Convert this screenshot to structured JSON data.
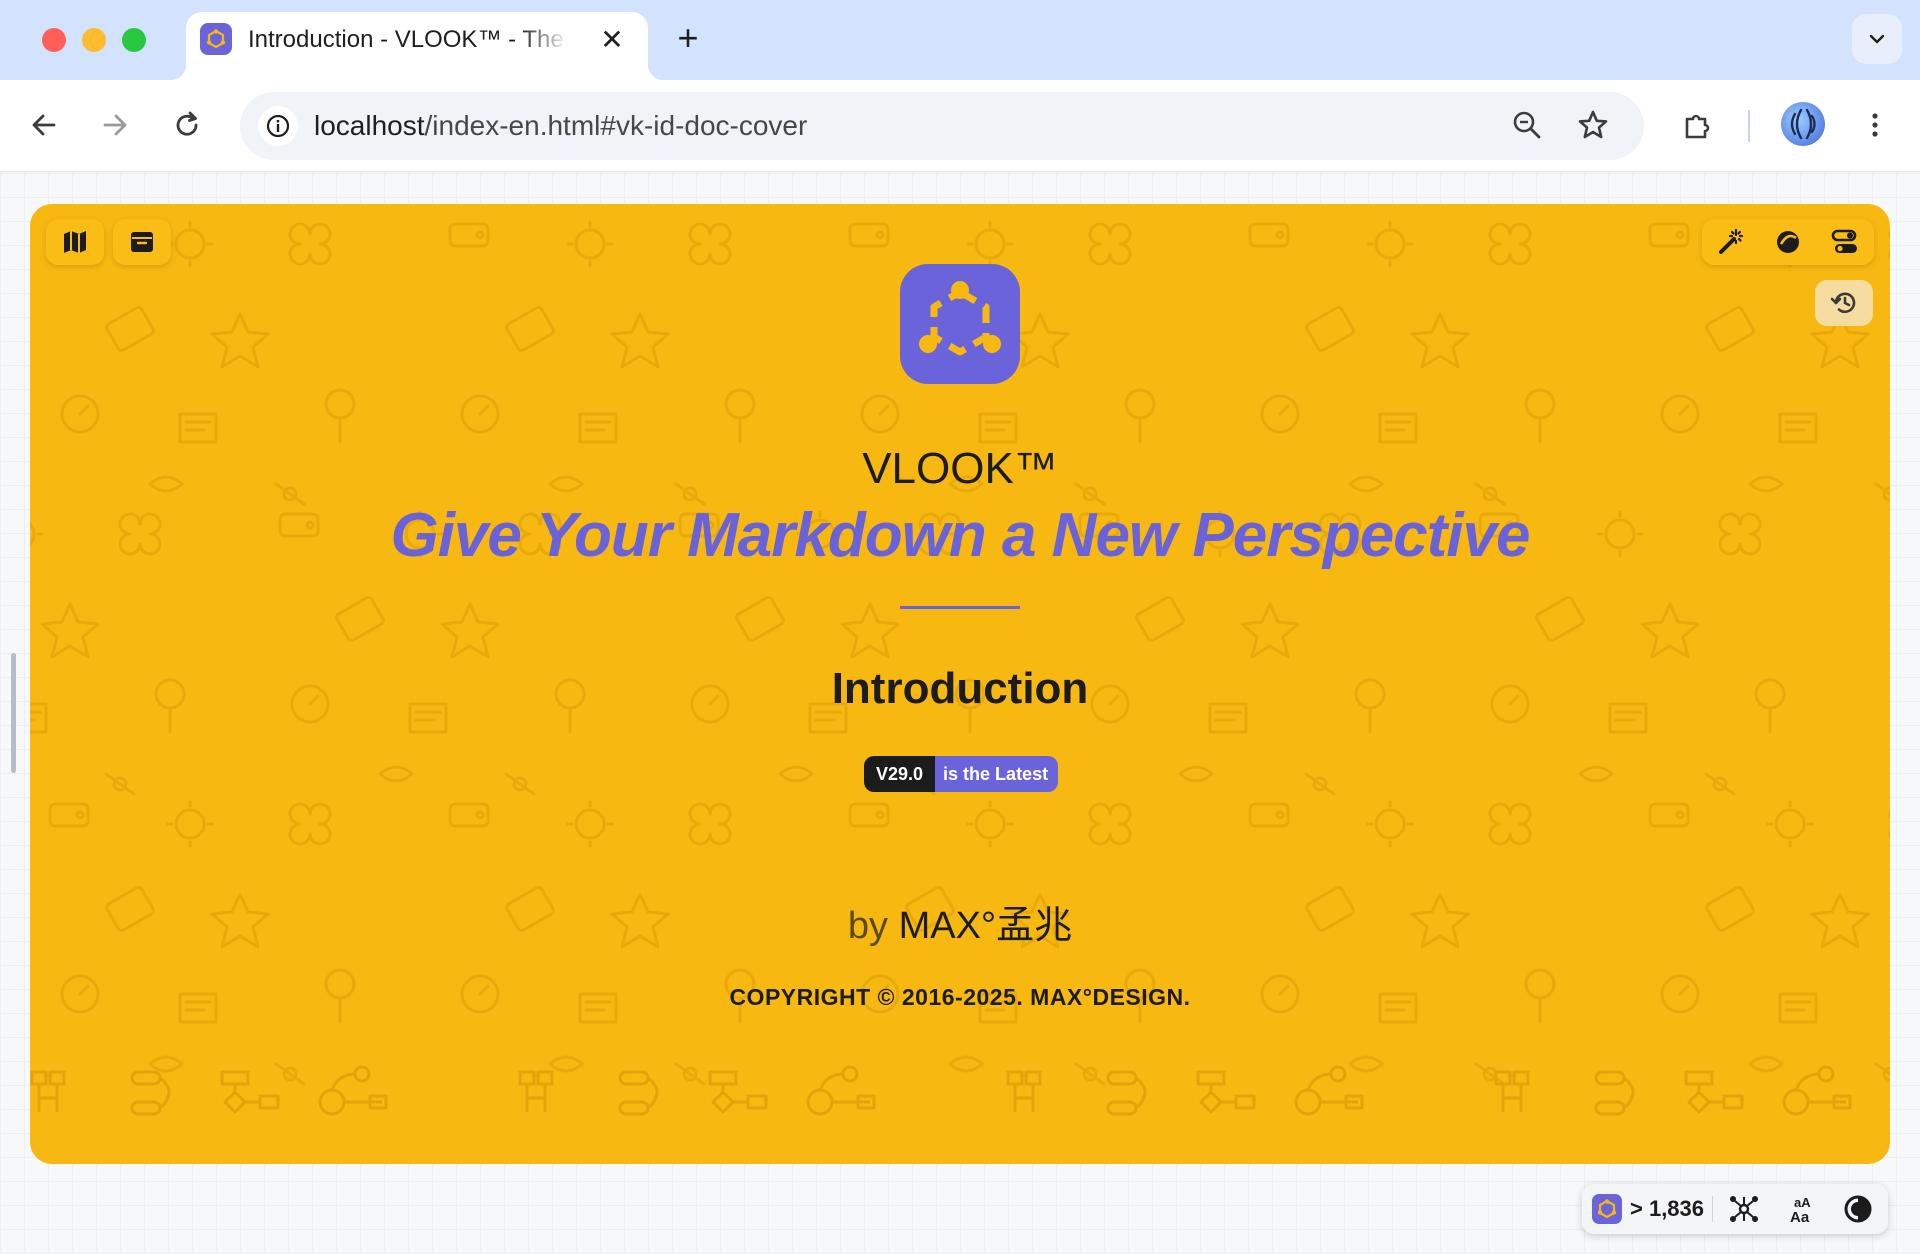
{
  "browser": {
    "tab": {
      "title": "Introduction - VLOOK™ - The Elegant & Practical THEME for Markdown"
    },
    "address_bar": {
      "host": "localhost",
      "path": "/index-en.html#vk-id-doc-cover"
    }
  },
  "cover": {
    "brand": "VLOOK™",
    "tagline": "Give Your Markdown a New Perspective",
    "doc_title": "Introduction",
    "badge": {
      "version": "V29.0",
      "message": "is the Latest"
    },
    "author": {
      "prefix": "by",
      "name": "MAX°孟兆"
    },
    "copyright": "COPYRIGHT © 2016-2025. MAX°DESIGN.",
    "colors": {
      "background": "#f7b911",
      "accent": "#6a62d8",
      "text": "#1c1c1c"
    }
  },
  "mini_toolbar": {
    "word_count": "> 1,836",
    "icons": [
      "vlook-logo-icon",
      "graph-icon",
      "font-size-icon",
      "contrast-icon"
    ]
  }
}
